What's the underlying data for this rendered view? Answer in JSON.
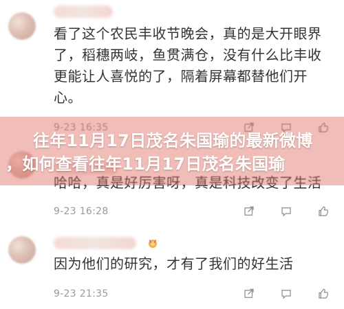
{
  "overlay": {
    "headline_line1": "往年11月17日茂名朱国瑜的最新微博",
    "headline_line2": "，如何查看往年11月17日茂名朱国瑜"
  },
  "comments": [
    {
      "text": "看了这个农民丰收节晚会，真的是大开眼界了，稻穗两岐，鱼贯满仓，没有什么比丰收更能让人喜悦的了，隔着屏幕都替他们开心。",
      "time": "9-23 16:35",
      "icons": [
        "share-icon",
        "comment-icon",
        "like-icon"
      ]
    },
    {
      "text": "哈哈，真是好厉害呀，真是科技改变了生活",
      "time": "9-23 16:28",
      "icons": [
        "share-icon",
        "comment-icon",
        "like-icon"
      ]
    },
    {
      "text": "因为他们的研究，才有了我们的好生活",
      "time": "9-23 21:35",
      "icons": [
        "share-icon",
        "comment-icon",
        "like-icon"
      ],
      "badge_icon": "medal-icon"
    }
  ]
}
